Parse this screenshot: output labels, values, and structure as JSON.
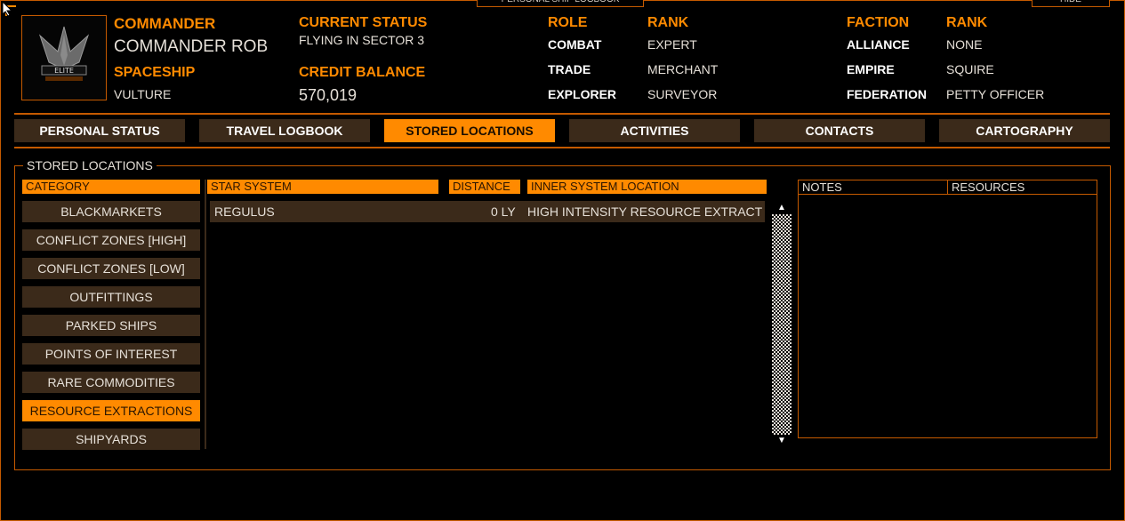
{
  "window": {
    "title": "PERSONAL SHIP LOGBOOK",
    "hide_label": "HIDE"
  },
  "commander": {
    "label": "COMMANDER",
    "name": "COMMANDER ROB",
    "spaceship_label": "SPACESHIP",
    "spaceship": "VULTURE",
    "status_label": "CURRENT STATUS",
    "status": "FLYING IN SECTOR 3",
    "credit_label": "CREDIT BALANCE",
    "credit": "570,019"
  },
  "roles": {
    "role_header": "ROLE",
    "rank_header": "RANK",
    "items": [
      {
        "role": "COMBAT",
        "rank": "EXPERT"
      },
      {
        "role": "TRADE",
        "rank": "MERCHANT"
      },
      {
        "role": "EXPLORER",
        "rank": "SURVEYOR"
      }
    ]
  },
  "factions": {
    "faction_header": "FACTION",
    "rank_header": "RANK",
    "items": [
      {
        "faction": "ALLIANCE",
        "rank": "NONE"
      },
      {
        "faction": "EMPIRE",
        "rank": "SQUIRE"
      },
      {
        "faction": "FEDERATION",
        "rank": "PETTY OFFICER"
      }
    ]
  },
  "tabs": [
    {
      "label": "PERSONAL STATUS"
    },
    {
      "label": "TRAVEL LOGBOOK"
    },
    {
      "label": "STORED LOCATIONS",
      "active": true
    },
    {
      "label": "ACTIVITIES"
    },
    {
      "label": "CONTACTS"
    },
    {
      "label": "CARTOGRAPHY"
    }
  ],
  "stored": {
    "title": "STORED LOCATIONS",
    "category_header": "CATEGORY",
    "categories": [
      "BLACKMARKETS",
      "CONFLICT ZONES [HIGH]",
      "CONFLICT ZONES [LOW]",
      "OUTFITTINGS",
      "PARKED SHIPS",
      "POINTS OF INTEREST",
      "RARE COMMODITIES",
      "RESOURCE EXTRACTIONS",
      "SHIPYARDS"
    ],
    "active_category": "RESOURCE EXTRACTIONS",
    "columns": {
      "system": "STAR SYSTEM",
      "distance": "DISTANCE",
      "location": "INNER SYSTEM LOCATION"
    },
    "rows": [
      {
        "system": "REGULUS",
        "distance": "0 LY",
        "location": "HIGH INTENSITY RESOURCE EXTRACTIC"
      }
    ],
    "notes_header": "NOTES",
    "resources_header": "RESOURCES"
  },
  "colors": {
    "accent": "#ff8a00",
    "border": "#c55a00",
    "panel": "#3b2a1a"
  }
}
